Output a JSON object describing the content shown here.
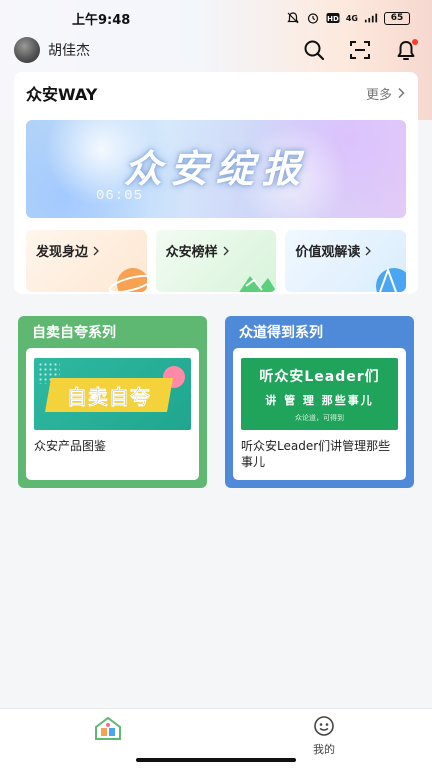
{
  "status_bar": {
    "time": "上午9:48",
    "network": "4G",
    "battery": "65"
  },
  "header": {
    "username": "胡佳杰"
  },
  "way": {
    "title": "众安WAY",
    "more_label": "更多",
    "banner": {
      "title": "众安绽报",
      "subtitle": "06:05"
    },
    "quick_links": [
      {
        "label": "发现身边"
      },
      {
        "label": "众安榜样"
      },
      {
        "label": "价值观解读"
      }
    ]
  },
  "series": [
    {
      "title": "自卖自夸系列",
      "thumb_text": "自卖自夸",
      "caption": "众安产品图鉴"
    },
    {
      "title": "众道得到系列",
      "thumb_line1": "听众安Leader们",
      "thumb_line2": "讲 管 理 那些事儿",
      "thumb_line3": "众论道，可得到",
      "caption": "听众安Leader们讲管理那些事儿"
    }
  ],
  "tab_bar": {
    "tabs": [
      {
        "label": ""
      },
      {
        "label": "我的"
      }
    ]
  },
  "colors": {
    "green_series": "#5fb871",
    "blue_series": "#4f8ad8",
    "notification_dot": "#ff3b30"
  }
}
